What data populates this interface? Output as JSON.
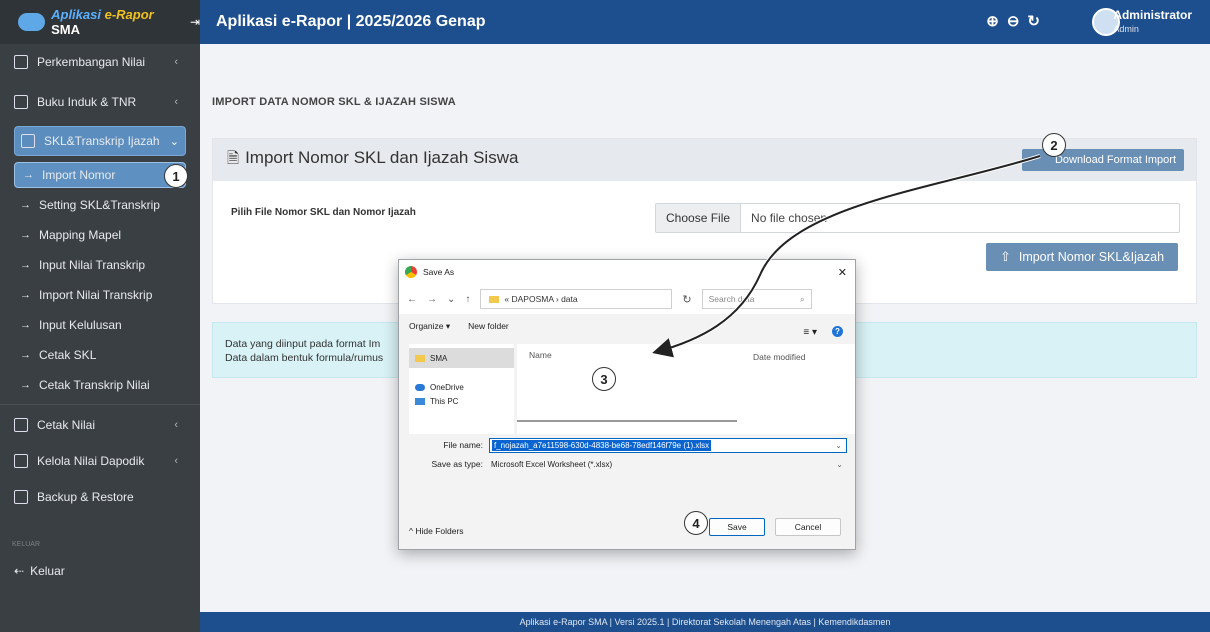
{
  "sidebar": {
    "brand": {
      "part1": "Aplikasi",
      "part2": "e-Rapor",
      "part3": "SMA",
      "toggle": "⇥"
    },
    "items": [
      {
        "label": "Perkembangan Nilai",
        "chev": "‹"
      },
      {
        "label": "Buku Induk & TNR",
        "chev": "‹"
      },
      {
        "label": "SKL&Transkrip Ijazah",
        "chev": "⌄"
      }
    ],
    "subitems": [
      {
        "label": "Import Nomor"
      },
      {
        "label": "Setting SKL&Transkrip"
      },
      {
        "label": "Mapping Mapel"
      },
      {
        "label": "Input Nilai Transkrip"
      },
      {
        "label": "Import Nilai Transkrip"
      },
      {
        "label": "Input Kelulusan"
      },
      {
        "label": "Cetak SKL"
      },
      {
        "label": "Cetak Transkrip Nilai"
      }
    ],
    "items2": [
      {
        "label": "Cetak Nilai",
        "chev": "‹"
      },
      {
        "label": "Kelola Nilai Dapodik",
        "chev": "‹"
      },
      {
        "label": "Backup & Restore",
        "chev": ""
      }
    ],
    "section_label": "KELUAR",
    "logout": "Keluar",
    "arrow": "→"
  },
  "topbar": {
    "title": "Aplikasi e-Rapor | 2025/2026 Genap",
    "zoom_in": "⊕",
    "zoom_out": "⊖",
    "reset": "↻",
    "user_name": "Administrator",
    "user_role": "Admin"
  },
  "main": {
    "breadcrumb": "IMPORT DATA NOMOR SKL & IJAZAH SISWA",
    "card_title": "Import Nomor SKL dan Ijazah Siswa",
    "download_button": "Download Format Import",
    "field_label": "Pilih File Nomor SKL dan Nomor Ijazah",
    "choose_file": "Choose File",
    "no_file": "No file chosen",
    "import_button": "Import Nomor SKL&Ijazah",
    "info_line1": "Data yang diinput pada format Im",
    "info_line2": "Data dalam bentuk formula/rumus"
  },
  "dialog": {
    "title": "Save As",
    "close": "✕",
    "address": "« DAPOSMA › data",
    "search_placeholder": "Search data",
    "organize": "Organize ▾",
    "new_folder": "New folder",
    "view": "≡ ▾",
    "help": "?",
    "nav": [
      "SMA",
      "OneDrive",
      "This PC"
    ],
    "col_name": "Name",
    "col_date": "Date modified",
    "file_name_label": "File name:",
    "file_name_value": "f_nojazah_a7e11598-630d-4838-be68-78edf146f79e (1).xlsx",
    "save_type_label": "Save as type:",
    "save_type_value": "Microsoft Excel Worksheet (*.xlsx)",
    "hide_folders": "^ Hide Folders",
    "save": "Save",
    "cancel": "Cancel"
  },
  "steps": [
    "1",
    "2",
    "3",
    "4"
  ],
  "footer": "Aplikasi e-Rapor SMA | Versi 2025.1 | Direktorat Sekolah Menengah Atas | Kemendikdasmen",
  "colors": {
    "primary": "#1d4f8f",
    "sidebar": "#3a3f44",
    "button": "#6a8fb5",
    "info": "#d8f2f6"
  }
}
